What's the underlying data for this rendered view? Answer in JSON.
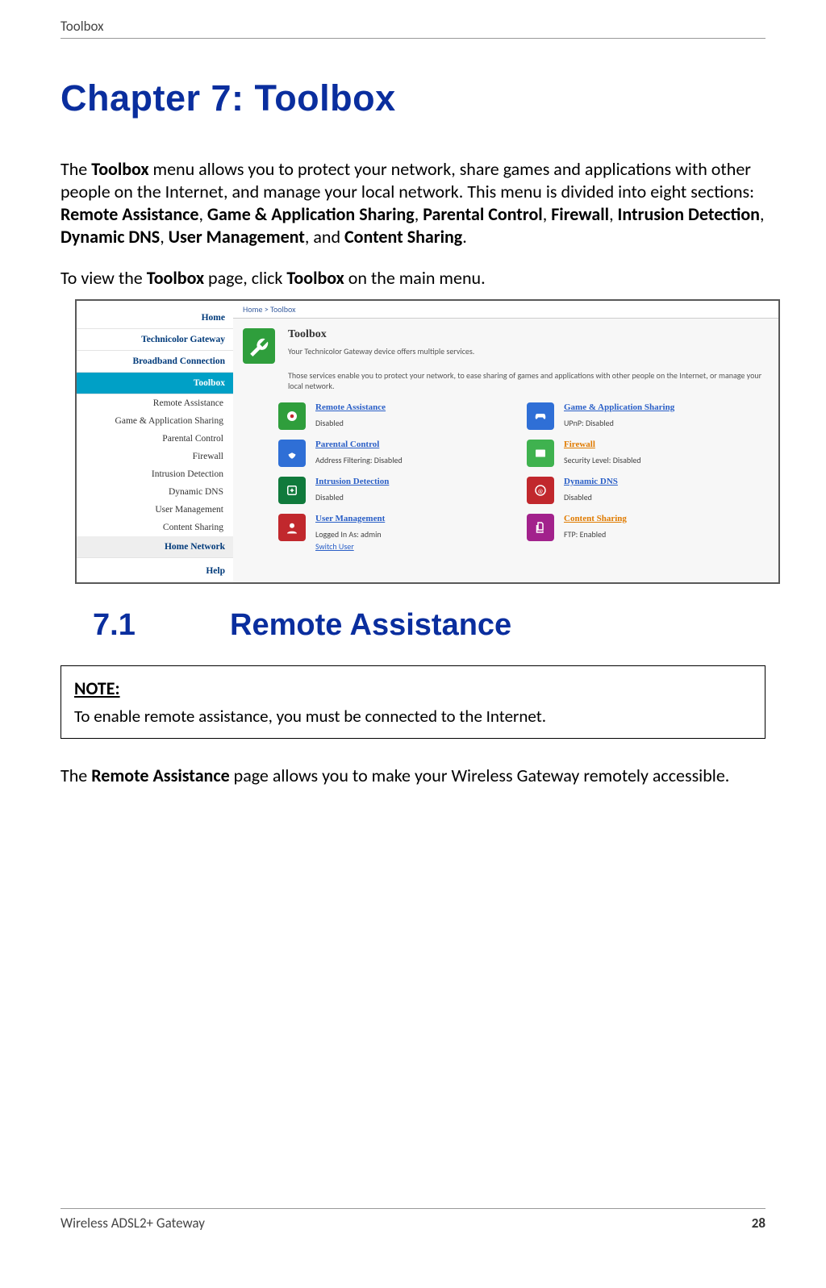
{
  "header": {
    "running_head": "Toolbox"
  },
  "chapter": {
    "title": "Chapter 7:  Toolbox"
  },
  "intro": {
    "p1_pre": "The ",
    "p1_b1": "Toolbox",
    "p1_mid": " menu allows you to protect your network, share games and applications with other people on the Internet, and manage your local network. This menu is divided into eight sections: ",
    "p1_b2": "Remote Assistance",
    "s2": ", ",
    "p1_b3": "Game & Application Sharing",
    "s3": ", ",
    "p1_b4": "Parental Control",
    "s4": ", ",
    "p1_b5": "Firewall",
    "s5": ", ",
    "p1_b6": "Intrusion Detection",
    "s6": ", ",
    "p1_b7": "Dynamic DNS",
    "s7": ", ",
    "p1_b8": "User Management",
    "s8": ", and ",
    "p1_b9": "Content Sharing",
    "s9": ".",
    "p2_pre": "To view the ",
    "p2_b1": "Toolbox",
    "p2_mid": " page, click ",
    "p2_b2": "Toolbox",
    "p2_end": " on the main menu."
  },
  "shot": {
    "crumb": "Home > Toolbox",
    "side": {
      "home": "Home",
      "gateway": "Technicolor Gateway",
      "broadband": "Broadband Connection",
      "toolbox": "Toolbox",
      "ra": "Remote Assistance",
      "gas": "Game & Application Sharing",
      "pc": "Parental Control",
      "fw": "Firewall",
      "id": "Intrusion Detection",
      "ddns": "Dynamic DNS",
      "um": "User Management",
      "cs": "Content Sharing",
      "hn": "Home Network",
      "help": "Help"
    },
    "main_title": "Toolbox",
    "main_sub1": "Your Technicolor Gateway device offers multiple services.",
    "main_sub2": "Those services enable you to protect your network, to ease sharing of games and applications with other people on the Internet, or manage your local network.",
    "grid": {
      "ra": {
        "title": "Remote Assistance",
        "status": "Disabled"
      },
      "gas": {
        "title": "Game & Application Sharing",
        "status": "UPnP: Disabled"
      },
      "pc": {
        "title": "Parental Control",
        "status": "Address Filtering: Disabled"
      },
      "fw": {
        "title": "Firewall",
        "status": "Security Level: Disabled"
      },
      "id": {
        "title": "Intrusion Detection",
        "status": "Disabled"
      },
      "ddns": {
        "title": "Dynamic DNS",
        "status": "Disabled"
      },
      "um": {
        "title": "User Management",
        "status": "Logged In As: admin",
        "switch": "Switch User"
      },
      "cs": {
        "title": "Content Sharing",
        "status": "FTP: Enabled"
      }
    }
  },
  "section": {
    "num": "7.1",
    "title": "Remote Assistance"
  },
  "note": {
    "label": "NOTE:",
    "body": "To enable remote assistance, you must be connected to the Internet."
  },
  "para": {
    "pre": "The ",
    "b1": "Remote Assistance",
    "post": " page allows you to make your Wireless Gateway remotely accessible."
  },
  "footer": {
    "product": "Wireless ADSL2+ Gateway",
    "page": "28"
  }
}
